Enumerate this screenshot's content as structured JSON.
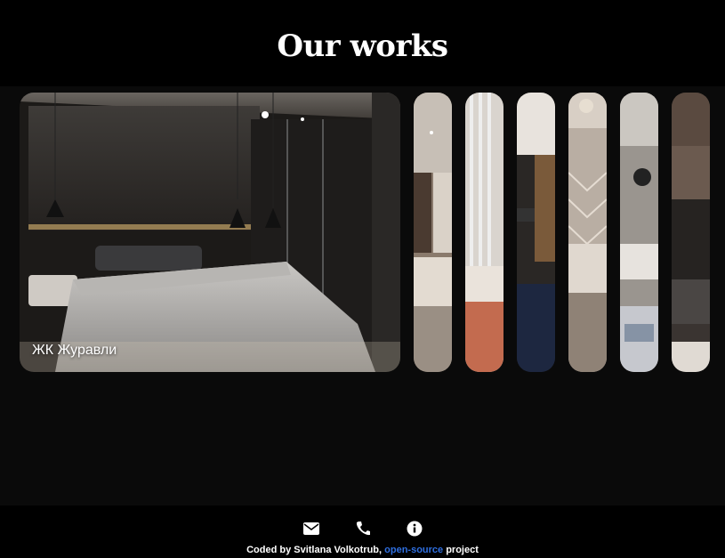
{
  "header": {
    "title": "Our works"
  },
  "gallery": {
    "active": {
      "label": "ЖК Журавли"
    },
    "thumb_count": 6
  },
  "footer": {
    "icons": [
      "envelope-icon",
      "phone-icon",
      "info-icon"
    ],
    "credit_prefix": "Coded by Svitlana Volkotrub, ",
    "credit_link": "open-source",
    "credit_suffix": " project"
  },
  "colors": {
    "background": "#0a0a0a",
    "header_bg": "#000000",
    "link": "#2f6fe0"
  }
}
